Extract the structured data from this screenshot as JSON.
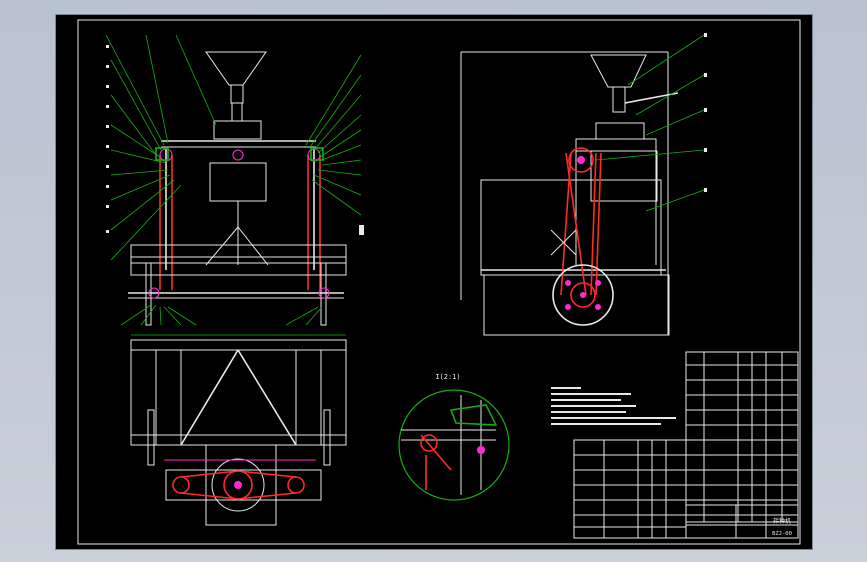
{
  "drawing": {
    "detail_label": "I(2:1)",
    "title_block": {
      "title": "拌种机",
      "drawing_number": "BZJ-00"
    }
  },
  "colors": {
    "background": "#000000",
    "outline": "#e8e8e8",
    "leader": "#13b013",
    "belt": "#ff2a2a",
    "hidden": "#ff2ad6"
  }
}
